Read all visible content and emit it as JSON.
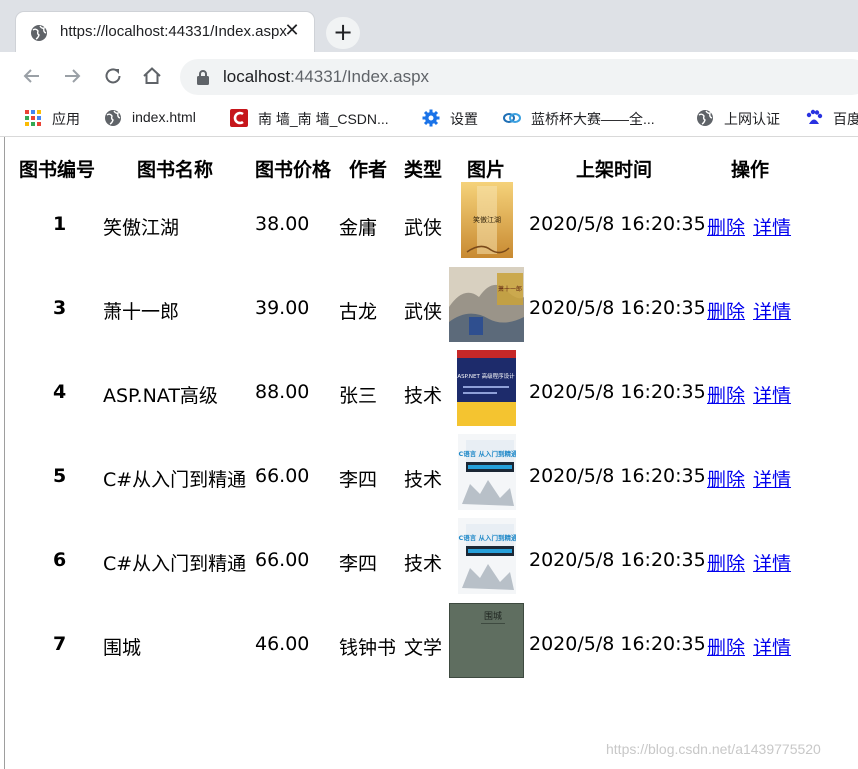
{
  "browser": {
    "tab_title": "https://localhost:44331/Index.aspx",
    "tab_close": "✕",
    "new_tab": "+",
    "url_host": "localhost",
    "url_rest": ":44331/Index.aspx"
  },
  "bookmarks": [
    {
      "label": "应用",
      "icon": "apps-grid-icon"
    },
    {
      "label": "index.html",
      "icon": "globe-icon"
    },
    {
      "label": "南 墙_南 墙_CSDN...",
      "icon": "csdn-icon"
    },
    {
      "label": "设置",
      "icon": "gear-icon"
    },
    {
      "label": "蓝桥杯大赛——全...",
      "icon": "lanqiao-icon"
    },
    {
      "label": "上网认证",
      "icon": "globe-icon"
    },
    {
      "label": "百度",
      "icon": "baidu-paw-icon"
    }
  ],
  "table": {
    "headers": [
      "图书编号",
      "图书名称",
      "图书价格",
      "作者",
      "类型",
      "图片",
      "上架时间",
      "操作"
    ],
    "delete_label": "删除",
    "detail_label": "详情",
    "rows": [
      {
        "id": "1",
        "name": "笑傲江湖",
        "price": "38.00",
        "author": "金庸",
        "type": "武侠",
        "time": "2020/5/8 16:20:35",
        "cover": "xiaoao",
        "cover_text": "笑傲江湖"
      },
      {
        "id": "3",
        "name": "萧十一郎",
        "price": "39.00",
        "author": "古龙",
        "type": "武侠",
        "time": "2020/5/8 16:20:35",
        "cover": "xiao11",
        "cover_text": "萧十一郎"
      },
      {
        "id": "4",
        "name": "ASP.NAT高级",
        "price": "88.00",
        "author": "张三",
        "type": "技术",
        "time": "2020/5/8 16:20:35",
        "cover": "aspnet",
        "cover_text": "ASP.NET 高级程序设计"
      },
      {
        "id": "5",
        "name": "C#从入门到精通",
        "price": "66.00",
        "author": "李四",
        "type": "技术",
        "time": "2020/5/8 16:20:35",
        "cover": "clang",
        "cover_text": "C语言 从入门到精通"
      },
      {
        "id": "6",
        "name": "C#从入门到精通",
        "price": "66.00",
        "author": "李四",
        "type": "技术",
        "time": "2020/5/8 16:20:35",
        "cover": "clang",
        "cover_text": "C语言 从入门到精通"
      },
      {
        "id": "7",
        "name": "围城",
        "price": "46.00",
        "author": "钱钟书",
        "type": "文学",
        "time": "2020/5/8 16:20:35",
        "cover": "weicheng",
        "cover_text": "围城"
      }
    ]
  },
  "watermark": "https://blog.csdn.net/a1439775520",
  "colors": {
    "link": "#0000ee",
    "tabstrip": "#dee1e6",
    "omnibox": "#f1f3f4"
  }
}
